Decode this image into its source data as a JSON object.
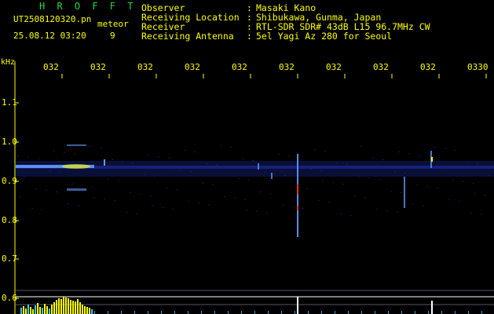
{
  "header": {
    "logo": "H R O F F T",
    "filename": "UT2508120320.pn",
    "type_label": "meteor",
    "datetime": "25.08.12 03:20",
    "count": "9"
  },
  "info": [
    {
      "label": "Observer",
      "value": "Masaki Kano"
    },
    {
      "label": "Receiving Location",
      "value": "Shibukawa, Gunma, Japan"
    },
    {
      "label": "Receiver",
      "value": "RTL-SDR SDR# 43dB L15 96.7MHz CW"
    },
    {
      "label": "Receiving Antenna",
      "value": "5el Yagi Az 280 for Seoul"
    }
  ],
  "info_separator": ":",
  "plot": {
    "y_unit": "kHz",
    "y_ticks": [
      "1.1",
      "1.0",
      "0.9",
      "0.8",
      "0.7",
      "0.6"
    ],
    "x_ticks": [
      "032",
      "032",
      "032",
      "032",
      "032",
      "032",
      "032",
      "032",
      "032",
      "0330"
    ],
    "colors": {
      "axis": "#ffff00",
      "grid": "#55556a",
      "noise": "#1a2a9a",
      "signal_hot": "#ffff00",
      "signal_warm": "#ff3300",
      "echo": "#6699ff",
      "baseline": "#ffffff",
      "bars_primary": "#ffff00",
      "bars_secondary": "#33ccff"
    }
  }
}
